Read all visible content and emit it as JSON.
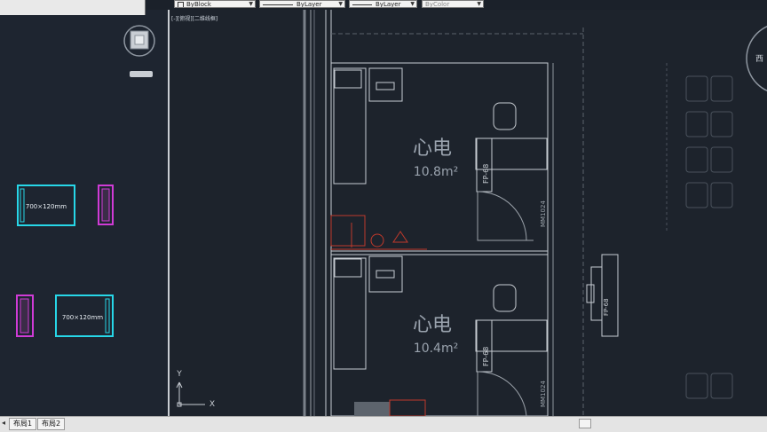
{
  "toolbar": {
    "color_combo": "ByBlock",
    "linetype_combo": "ByLayer",
    "lineweight_combo": "ByLayer",
    "plotstyle_combo": "ByColor"
  },
  "viewport": {
    "label": "[-][俯视][二维线框]",
    "wcs_label": "WCS",
    "compass_east": "西",
    "ucs_y": "Y",
    "ucs_x": "X"
  },
  "palette": {
    "block_label": "700×120mm"
  },
  "rooms": [
    {
      "name": "心电",
      "area": "10.8m²",
      "equipment_tag": "FP-68",
      "door_tag": "MM1024"
    },
    {
      "name": "心电",
      "area": "10.4m²",
      "equipment_tag": "FP-68",
      "door_tag": "MM1024"
    }
  ],
  "corridor": {
    "equipment_tag": "FP-68"
  },
  "layout_tabs": [
    "布局1",
    "布局2"
  ],
  "colors": {
    "background": "#1d232c",
    "wall_line": "#c8cdd3",
    "cyan_block": "#27d7e8",
    "magenta_block": "#d03bd6",
    "red_symbol": "#c0392b"
  }
}
